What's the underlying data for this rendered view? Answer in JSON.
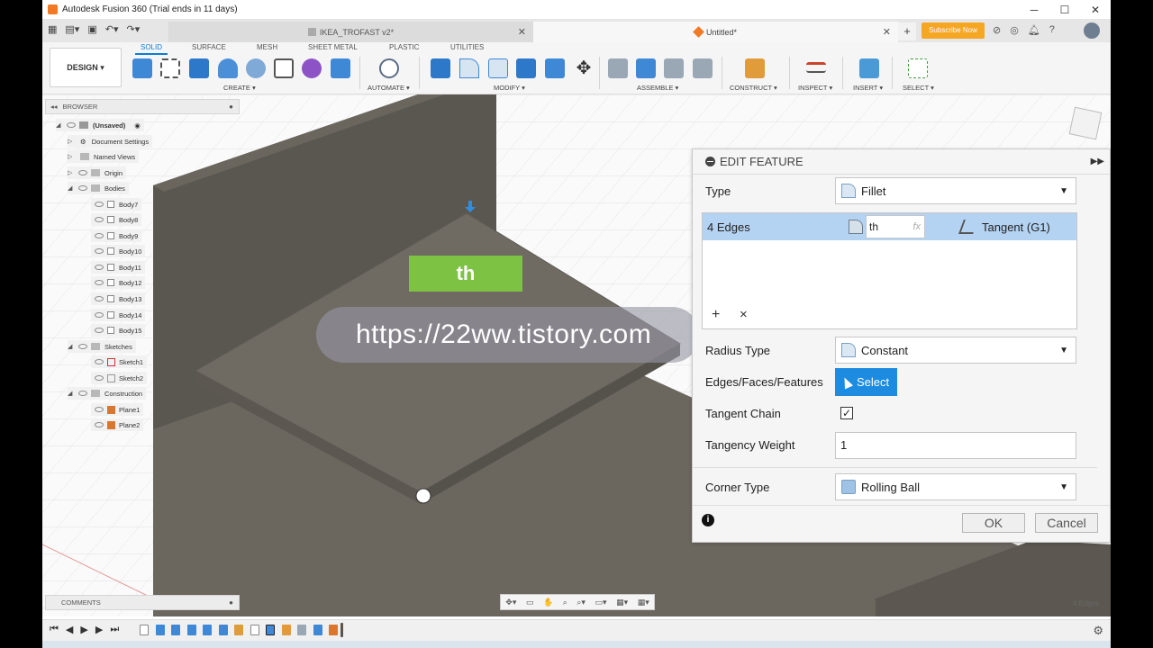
{
  "window": {
    "title": "Autodesk Fusion 360 (Trial ends in 11 days)"
  },
  "tabs": [
    {
      "label": "IKEA_TROFAST v2*"
    },
    {
      "label": "Untitled*"
    }
  ],
  "subscribe_label": "Subscribe Now",
  "toolbar": {
    "design_label": "DESIGN ▾",
    "workspace_tabs": [
      "SOLID",
      "SURFACE",
      "MESH",
      "SHEET METAL",
      "PLASTIC",
      "UTILITIES"
    ],
    "groups": [
      "CREATE ▾",
      "AUTOMATE ▾",
      "MODIFY ▾",
      "ASSEMBLE ▾",
      "CONSTRUCT ▾",
      "INSPECT ▾",
      "INSERT ▾",
      "SELECT ▾"
    ]
  },
  "browser": {
    "title": "BROWSER",
    "root": "(Unsaved)",
    "items": [
      {
        "label": "Document Settings"
      },
      {
        "label": "Named Views"
      },
      {
        "label": "Origin"
      },
      {
        "label": "Bodies"
      },
      {
        "label": "Body7"
      },
      {
        "label": "Body8"
      },
      {
        "label": "Body9"
      },
      {
        "label": "Body10"
      },
      {
        "label": "Body11"
      },
      {
        "label": "Body12"
      },
      {
        "label": "Body13"
      },
      {
        "label": "Body14"
      },
      {
        "label": "Body15"
      },
      {
        "label": "Sketches"
      },
      {
        "label": "Sketch1"
      },
      {
        "label": "Sketch2"
      },
      {
        "label": "Construction"
      },
      {
        "label": "Plane1"
      },
      {
        "label": "Plane2"
      }
    ]
  },
  "comments_label": "COMMENTS",
  "status": {
    "selection": "4 Edges"
  },
  "overlay": {
    "tag": "th",
    "url": "https://22ww.tistory.com"
  },
  "dialog": {
    "title": "EDIT FEATURE",
    "type_label": "Type",
    "type_value": "Fillet",
    "edges_label": "4 Edges",
    "radius_value": "th",
    "fx": "fx",
    "continuity": "Tangent (G1)",
    "add": "+",
    "remove": "×",
    "radius_type_label": "Radius Type",
    "radius_type_value": "Constant",
    "edges_faces_label": "Edges/Faces/Features",
    "select_label": "Select",
    "tangent_chain_label": "Tangent Chain",
    "tangent_chain_checked": "✓",
    "tangency_weight_label": "Tangency Weight",
    "tangency_weight_value": "1",
    "corner_type_label": "Corner Type",
    "corner_type_value": "Rolling Ball",
    "ok_label": "OK",
    "cancel_label": "Cancel"
  }
}
